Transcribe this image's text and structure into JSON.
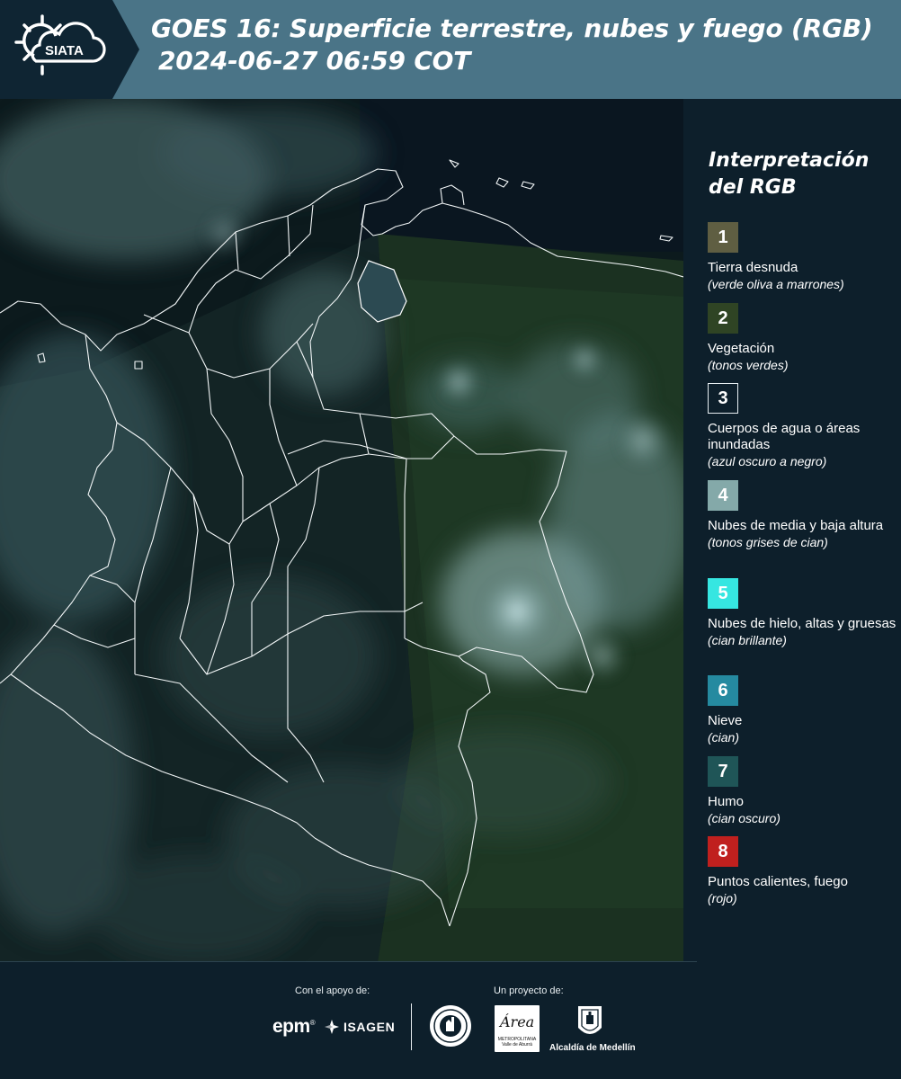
{
  "header": {
    "logo_text": "SIATA",
    "title_line1": "GOES 16: Superficie terrestre, nubes y fuego (RGB)",
    "title_line2": "2024-06-27 06:59 COT",
    "background_color": "#4a7487",
    "logo_panel_color": "#0f2533"
  },
  "legend": {
    "title": "Interpretación del RGB",
    "items": [
      {
        "number": "1",
        "label": "Tierra desnuda",
        "note": "(verde oliva a marrones)",
        "color": "#5f5e42"
      },
      {
        "number": "2",
        "label": "Vegetación",
        "note": "(tonos verdes)",
        "color": "#2f4424"
      },
      {
        "number": "3",
        "label": "Cuerpos de agua o áreas inundadas",
        "note": "(azul oscuro a negro)",
        "color": "#0d1f2b"
      },
      {
        "number": "4",
        "label": "Nubes de media y baja altura",
        "note": "(tonos grises de cian)",
        "color": "#84a9a9"
      },
      {
        "number": "5",
        "label": "Nubes de hielo, altas y gruesas",
        "note": "(cian brillante)",
        "color": "#36e6e1"
      },
      {
        "number": "6",
        "label": "Nieve",
        "note": "(cian)",
        "color": "#258aa0"
      },
      {
        "number": "7",
        "label": "Humo",
        "note": "(cian oscuro)",
        "color": "#1f5557"
      },
      {
        "number": "8",
        "label": "Puntos calientes, fuego",
        "note": "(rojo)",
        "color": "#c0201e"
      }
    ]
  },
  "footer": {
    "support_label": "Con el apoyo de:",
    "project_label": "Un proyecto de:",
    "epm_logo": "epm",
    "epm_mark": "®",
    "isagen_logo": "ISAGEN",
    "area_logo_word": "Área",
    "area_logo_sub": "METROPOLITANA Valle de Aburrá",
    "alcaldia_label": "Alcaldía de Medellín"
  }
}
